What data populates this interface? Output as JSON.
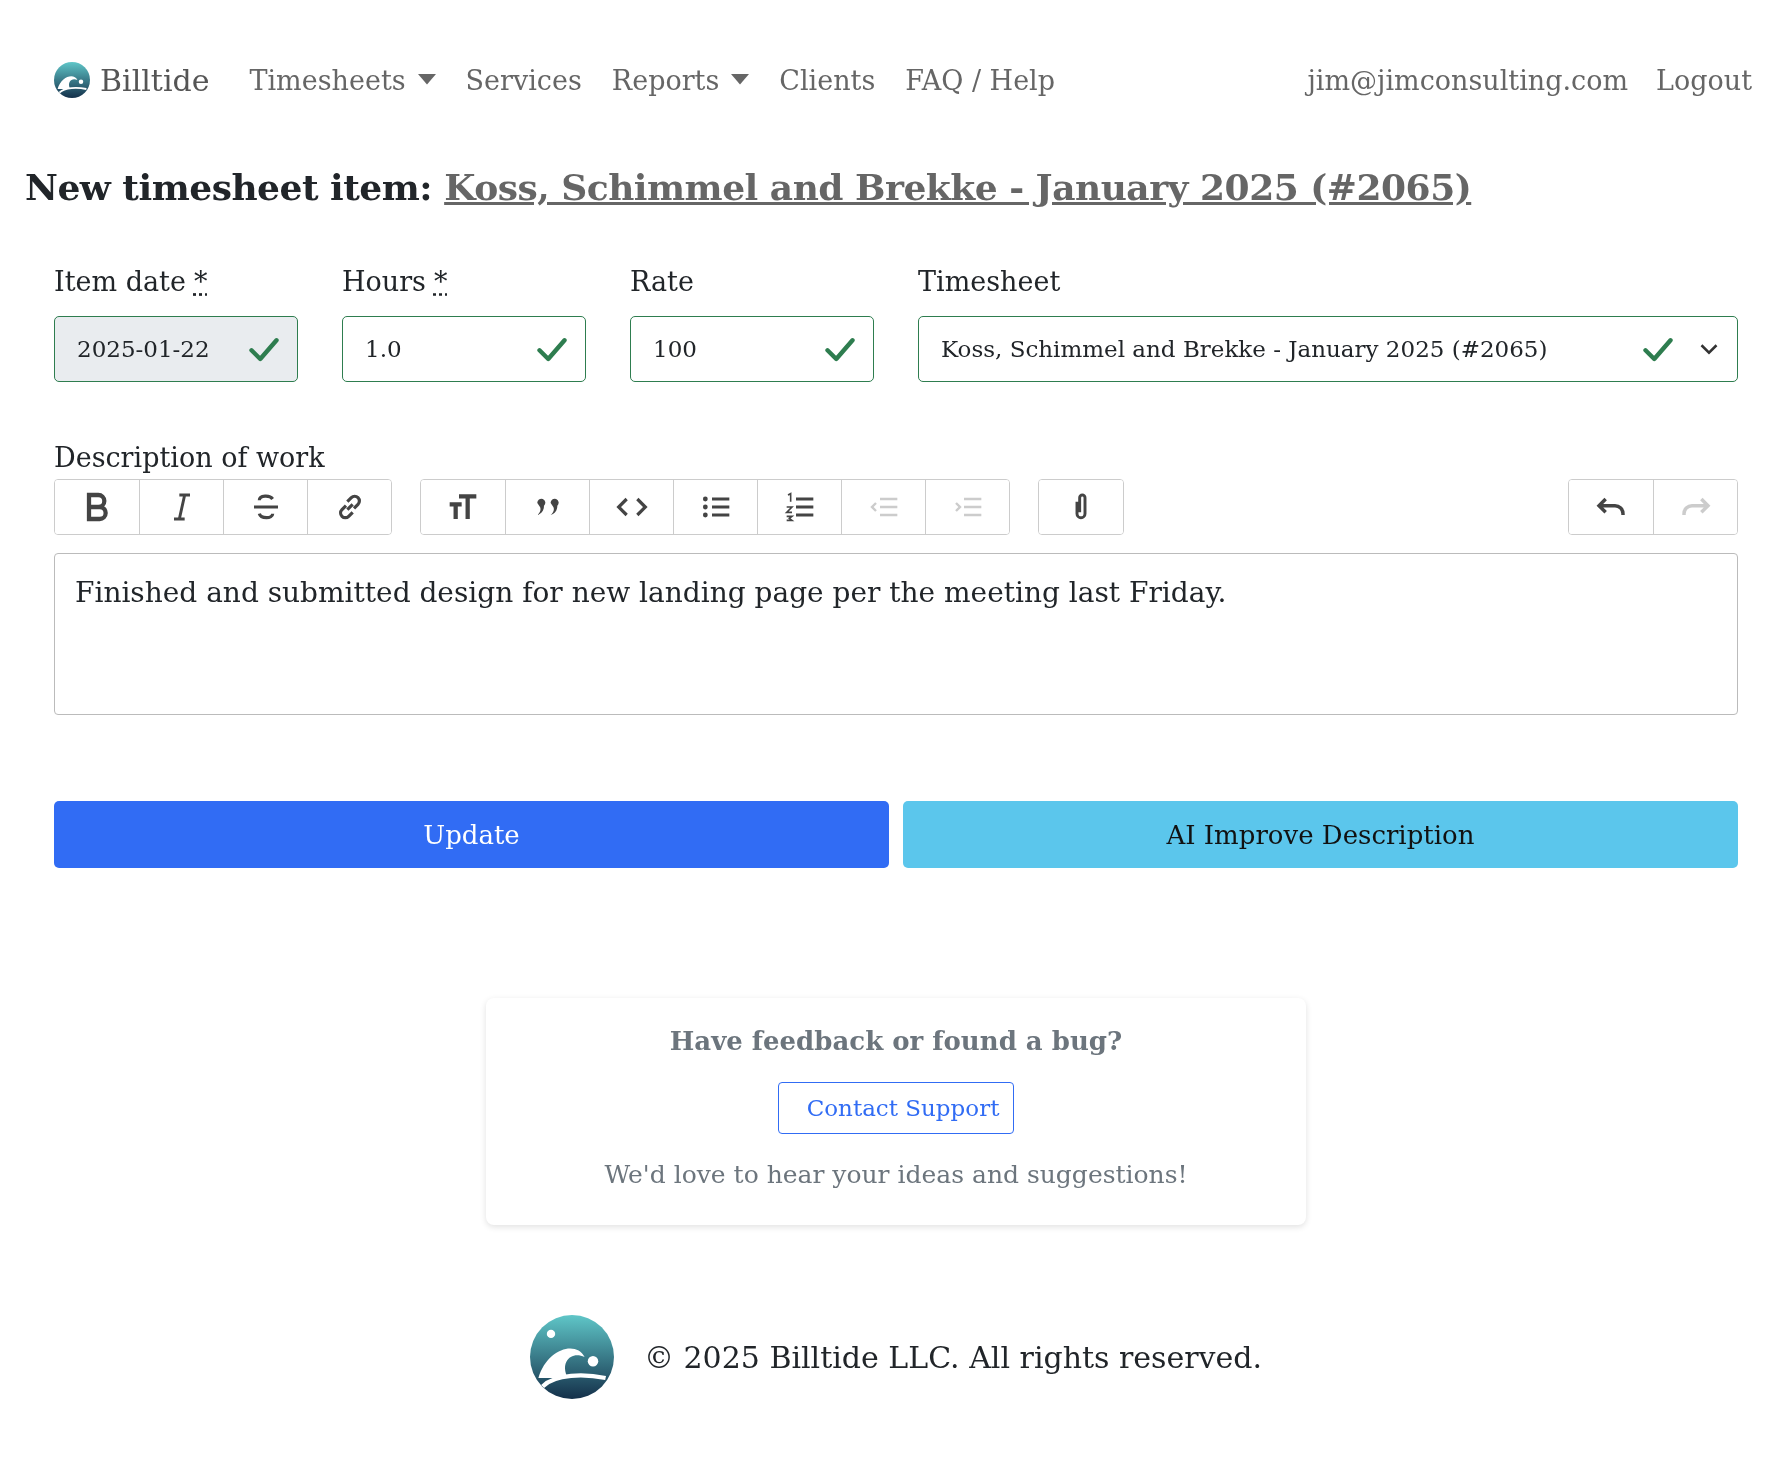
{
  "navbar": {
    "brand": "Billtide",
    "items": [
      {
        "label": "Timesheets",
        "dropdown": true
      },
      {
        "label": "Services",
        "dropdown": false
      },
      {
        "label": "Reports",
        "dropdown": true
      },
      {
        "label": "Clients",
        "dropdown": false
      },
      {
        "label": "FAQ / Help",
        "dropdown": false
      }
    ],
    "user_email": "jim@jimconsulting.com",
    "logout": "Logout"
  },
  "page_title": {
    "prefix": "New timesheet item:",
    "link": "Koss, Schimmel and Brekke - January 2025 (#2065)"
  },
  "fields": [
    {
      "kind": "text",
      "label": "Item date",
      "required_mark": "*",
      "value": "2025-01-22",
      "readonly": true,
      "valid": true
    },
    {
      "kind": "text",
      "label": "Hours",
      "required_mark": "*",
      "value": "1.0",
      "readonly": false,
      "valid": true
    },
    {
      "kind": "text",
      "label": "Rate",
      "value": "100",
      "readonly": false,
      "valid": true
    },
    {
      "kind": "select",
      "label": "Timesheet",
      "value": "Koss, Schimmel and Brekke - January 2025 (#2065)",
      "readonly": false,
      "valid": true
    }
  ],
  "description": {
    "label": "Description of work",
    "toolbar": {
      "formatting_groups": [
        {
          "buttons": [
            {
              "disabled": false
            },
            {
              "disabled": false
            },
            {
              "disabled": false
            },
            {
              "disabled": false
            }
          ]
        },
        {
          "buttons": [
            {
              "disabled": false
            },
            {
              "disabled": false
            },
            {
              "disabled": false
            },
            {
              "disabled": false
            },
            {
              "disabled": false
            },
            {
              "disabled": true
            },
            {
              "disabled": true
            }
          ]
        },
        {
          "buttons": [
            {
              "disabled": false
            }
          ]
        }
      ],
      "history_group": {
        "buttons": [
          {
            "disabled": false
          },
          {
            "disabled": true
          }
        ]
      }
    },
    "text": "Finished and submitted design for new landing page per the meeting last Friday."
  },
  "actions": [
    {
      "kind": "primary",
      "label": "Update"
    },
    {
      "kind": "info",
      "label": "AI Improve Description"
    }
  ],
  "feedback": {
    "heading": "Have feedback or found a bug?",
    "button": "Contact Support",
    "note": "We'd love to hear your ideas and suggestions!"
  },
  "footer": {
    "copyright": "© 2025 Billtide LLC. All rights reserved."
  }
}
